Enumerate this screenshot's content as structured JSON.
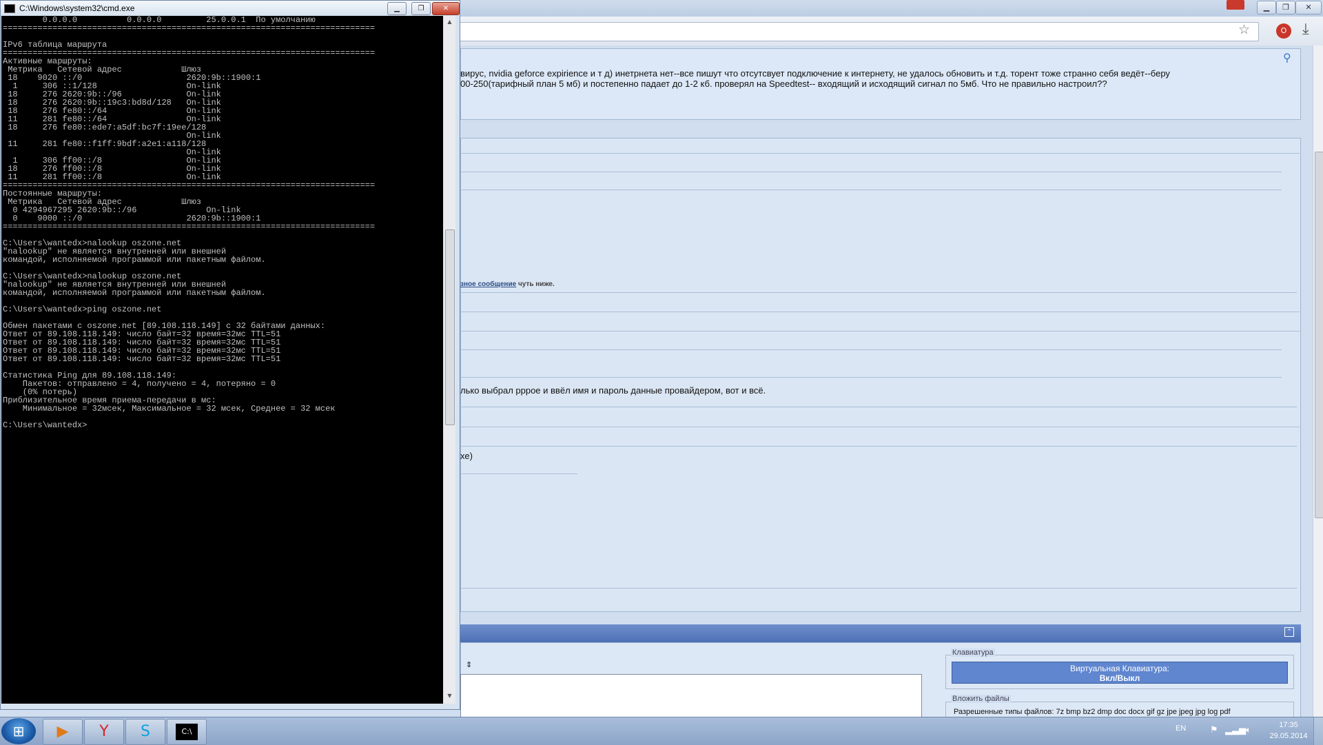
{
  "cmd": {
    "title": "C:\\Windows\\system32\\cmd.exe",
    "buttons": {
      "minimize": "▁",
      "maximize": "❐",
      "close": "✕"
    },
    "console_lines": [
      "        0.0.0.0          0.0.0.0         25.0.0.1  По умолчанию",
      "===========================================================================",
      "",
      "IPv6 таблица маршрута",
      "===========================================================================",
      "Активные маршруты:",
      " Метрика   Сетевой адрес            Шлюз",
      " 18    9020 ::/0                     2620:9b::1900:1",
      "  1     306 ::1/128                  On-link",
      " 18     276 2620:9b::/96             On-link",
      " 18     276 2620:9b::19c3:bd8d/128   On-link",
      " 18     276 fe80::/64                On-link",
      " 11     281 fe80::/64                On-link",
      " 18     276 fe80::ede7:a5df:bc7f:19ee/128",
      "                                     On-link",
      " 11     281 fe80::f1ff:9bdf:a2e1:a118/128",
      "                                     On-link",
      "  1     306 ff00::/8                 On-link",
      " 18     276 ff00::/8                 On-link",
      " 11     281 ff00::/8                 On-link",
      "===========================================================================",
      "Постоянные маршруты:",
      " Метрика   Сетевой адрес            Шлюз",
      "  0 4294967295 2620:9b::/96              On-link",
      "  0    9000 ::/0                     2620:9b::1900:1",
      "===========================================================================",
      "",
      "C:\\Users\\wantedx>nalookup oszone.net",
      "\"nalookup\" не является внутренней или внешней",
      "командой, исполняемой программой или пакетным файлом.",
      "",
      "C:\\Users\\wantedx>nalookup oszone.net",
      "\"nalookup\" не является внутренней или внешней",
      "командой, исполняемой программой или пакетным файлом.",
      "",
      "C:\\Users\\wantedx>ping oszone.net",
      "",
      "Обмен пакетами с oszone.net [89.108.118.149] с 32 байтами данных:",
      "Ответ от 89.108.118.149: число байт=32 время=32мс TTL=51",
      "Ответ от 89.108.118.149: число байт=32 время=32мс TTL=51",
      "Ответ от 89.108.118.149: число байт=32 время=32мс TTL=51",
      "Ответ от 89.108.118.149: число байт=32 время=32мс TTL=51",
      "",
      "Статистика Ping для 89.108.118.149:",
      "    Пакетов: отправлено = 4, получено = 4, потеряно = 0",
      "    (0% потерь)",
      "Приблизительное время приема-передачи в мс:",
      "    Минимальное = 32мсек, Максимальное = 32 мсек, Среднее = 32 мсек",
      "",
      "C:\\Users\\wantedx>"
    ]
  },
  "browser": {
    "post_text_line1": "вирус, nvidia geforce expirience и т д) инетрнета нет--все пишут что отсутсвует подключение к интернету, не удалось обновить и т.д. торент тоже странно себя ведёт--беру",
    "post_text_line2": "00-250(тарифный план 5 мб) и постепенно падает до 1-2 кб. проверял на Speedtest-- входящий и исходящий сигнал по 5мб. Что не правильно настроил??",
    "note_link": "зное сообщение",
    "note_rest": " чуть ниже.",
    "reply_text": "лько выбрал рррое и ввёл имя и пароль данные провайдером, вот и всё.",
    "fragment_text": "хе)",
    "editor_toggle": "⇕",
    "keyboard_legend": "Клавиатура",
    "keyboard_button_line1": "Виртуальная Клавиатура:",
    "keyboard_button_line2": "Вкл/Выкл",
    "attach_legend": "Вложить файлы",
    "attach_types": "Разрешенные типы файлов: 7z bmp bz2 dmp doc docx gif gz jpe jpeg jpg log pdf"
  },
  "taskbar": {
    "start_glyph": "⊞",
    "tasks": [
      {
        "name": "media-player",
        "glyph": "▶",
        "color": "#e07b18"
      },
      {
        "name": "yandex-browser",
        "glyph": "Y",
        "color": "#d7262b"
      },
      {
        "name": "skype",
        "glyph": "S",
        "color": "#0fa0dc"
      },
      {
        "name": "cmd",
        "glyph": "C:\\",
        "color": "#ffffff"
      }
    ],
    "language": "EN",
    "clock_time": "17:35",
    "clock_date": "29.05.2014"
  },
  "colors": {
    "console_bg": "#000000",
    "console_fg": "#c0c0c0",
    "page_bg": "#d0deef",
    "accent": "#5f86cf"
  }
}
